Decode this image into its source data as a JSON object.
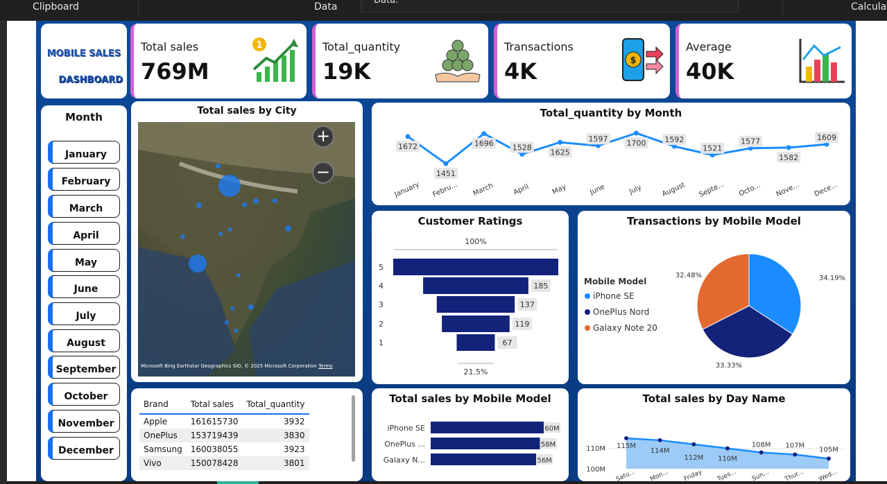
{
  "topbar": {
    "clipboard": "Clipboard",
    "data": "Data",
    "fragment": "Data.",
    "calculation": "Calculat"
  },
  "logo": {
    "line1": "MOBILE SALES",
    "line2": "DASHBOARD"
  },
  "kpis": [
    {
      "label": "Total sales",
      "value": "769M"
    },
    {
      "label": "Total_quantity",
      "value": "19K"
    },
    {
      "label": "Transactions",
      "value": "4K"
    },
    {
      "label": "Average",
      "value": "40K"
    }
  ],
  "month_slicer": {
    "title": "Month",
    "items": [
      "January",
      "February",
      "March",
      "April",
      "May",
      "June",
      "July",
      "August",
      "September",
      "October",
      "November",
      "December"
    ]
  },
  "map": {
    "title": "Total sales by City",
    "attribution": "Microsoft Bing",
    "copyright": "Earthstar Geographics SIO, © 2025 Microsoft Corporation",
    "terms": "Terms"
  },
  "brand_table": {
    "headers": [
      "Brand",
      "Total sales",
      "Total_quantity"
    ],
    "rows": [
      [
        "Apple",
        "161615730",
        "3932"
      ],
      [
        "OnePlus",
        "153719439",
        "3830"
      ],
      [
        "Samsung",
        "160038055",
        "3923"
      ],
      [
        "Vivo",
        "150078428",
        "3801"
      ]
    ]
  },
  "charts": {
    "quantity_by_month": {
      "title": "Total_quantity by Month",
      "labels": [
        "January",
        "Febru...",
        "March",
        "April",
        "May",
        "June",
        "July",
        "August",
        "Septe...",
        "Octo...",
        "Nove...",
        "Dece..."
      ]
    },
    "ratings": {
      "title": "Customer Ratings",
      "top_label": "100%",
      "bottom_label": "21.5%"
    },
    "transactions_by_model": {
      "title": "Transactions by Mobile Model",
      "legend_title": "Mobile Model"
    },
    "sales_by_model": {
      "title": "Total sales by Mobile Model"
    },
    "sales_by_day": {
      "title": "Total sales by Day Name",
      "y_ticks": [
        "110M",
        "100M"
      ]
    }
  },
  "chart_data": [
    {
      "type": "line",
      "title": "Total_quantity by Month",
      "categories": [
        "January",
        "Febru...",
        "March",
        "April",
        "May",
        "June",
        "July",
        "August",
        "Septe...",
        "Octo...",
        "Nove...",
        "Dece..."
      ],
      "values": [
        1672,
        1451,
        1696,
        1528,
        1625,
        1597,
        1700,
        1592,
        1521,
        1577,
        1582,
        1609
      ],
      "color": "#1a8cff"
    },
    {
      "type": "bar",
      "title": "Customer Ratings",
      "categories": [
        "5",
        "4",
        "3",
        "2",
        "1"
      ],
      "values": [
        null,
        185,
        137,
        119,
        67
      ],
      "color": "#13237a"
    },
    {
      "type": "pie",
      "title": "Transactions by Mobile Model",
      "legend_title": "Mobile Model",
      "categories": [
        "iPhone SE",
        "OnePlus Nord",
        "Galaxy Note 20"
      ],
      "values": [
        34.19,
        33.33,
        32.48
      ],
      "value_labels": [
        "34.19%",
        "33.33%",
        "32.48%"
      ],
      "colors": [
        "#1a8cff",
        "#13237a",
        "#e36a30"
      ]
    },
    {
      "type": "bar",
      "title": "Total sales by Mobile Model",
      "categories": [
        "iPhone SE",
        "OnePlus ...",
        "Galaxy N..."
      ],
      "values": [
        60,
        58,
        56
      ],
      "value_labels": [
        "60M",
        "58M",
        "56M"
      ],
      "color": "#13237a"
    },
    {
      "type": "area",
      "title": "Total sales by Day Name",
      "categories": [
        "Satu...",
        "Mon...",
        "Friday",
        "Tues...",
        "Sun...",
        "Thur...",
        "Wed..."
      ],
      "values": [
        115,
        114,
        112,
        110,
        108,
        107,
        105
      ],
      "value_labels": [
        "115M",
        "114M",
        "112M",
        "110M",
        "108M",
        "107M",
        "105M"
      ],
      "ylim": [
        100,
        110
      ],
      "color": "#1a8cff"
    }
  ]
}
